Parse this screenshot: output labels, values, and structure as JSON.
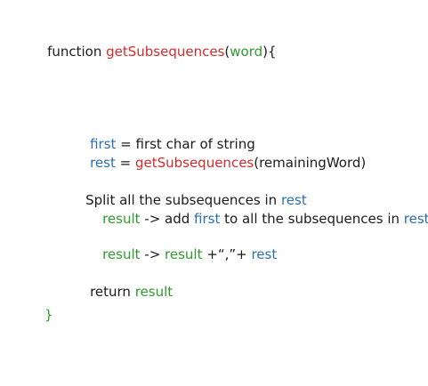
{
  "colors": {
    "text": "#1b1b1b",
    "red": "#d22b2b",
    "green": "#2f9a2f",
    "blue": "#2b6fae"
  },
  "code": {
    "line1": {
      "kw": "function ",
      "name": "getSubsequences",
      "open": "(",
      "param": "word",
      "close": "){"
    },
    "line2": {
      "var": "first",
      "eq": " = ",
      "text": "first char of string"
    },
    "line3": {
      "var": "rest",
      "eq": " = ",
      "call": "getSubsequences",
      "args": "(remainingWord)"
    },
    "line4": {
      "text": "Split all the subsequences in ",
      "var": "rest"
    },
    "line5": {
      "res": "result",
      "mid": " -> add ",
      "first": "first",
      "mid2": " to all the subsequences in ",
      "rest": "rest"
    },
    "line6": {
      "res1": "result",
      "mid": " -> ",
      "res2": "result",
      "mid2": " +“,”+ ",
      "rest": "rest"
    },
    "line7": {
      "kw": "return ",
      "res": "result"
    },
    "line8": {
      "brace": "}"
    }
  }
}
